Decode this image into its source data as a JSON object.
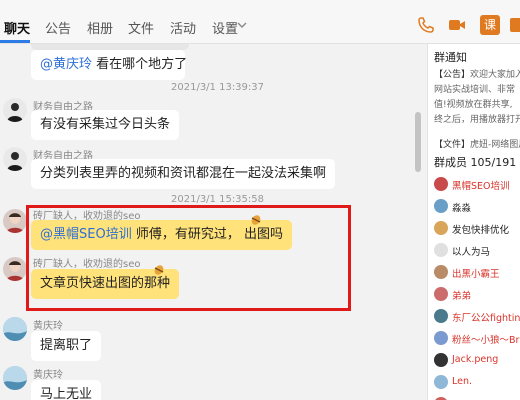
{
  "tabs": [
    {
      "label": "聊天",
      "active": true
    },
    {
      "label": "公告"
    },
    {
      "label": "相册"
    },
    {
      "label": "文件"
    },
    {
      "label": "活动"
    },
    {
      "label": "设置"
    }
  ],
  "toolbar": {
    "phone_icon": "phone-icon",
    "video_icon": "video-icon",
    "lesson_label": "课",
    "more_icon": "more-icon"
  },
  "chat": {
    "prev_mention": "@黄庆玲",
    "prev_text": " 看在哪个地方了",
    "time1": "2021/3/1 13:39:37",
    "msg1_sender": "财务自由之路",
    "msg1_text": "有没有采集过今日头条",
    "msg2_sender": "财务自由之路",
    "msg2_text": "分类列表里弄的视频和资讯都混在一起没法采集啊",
    "time2": "2021/3/1 15:35:58",
    "msg3_sender": "砖厂缺人，收劝退的seo",
    "msg3_mention": "@黑帽SEO培训",
    "msg3_text": " 师傅，有研究过， 出图吗",
    "msg4_sender": "砖厂缺人，收劝退的seo",
    "msg4_text": "文章页快速出图的那种",
    "msg5_sender": "黄庆玲",
    "msg5_text": "提离职了",
    "msg6_sender": "黄庆玲",
    "msg6_text": "马上无业",
    "highlight_color": "#e01919",
    "bubble_highlight_color": "#ffe27a"
  },
  "panel": {
    "notice_title": "群通知",
    "notice_lines": [
      {
        "tag": "【公告】",
        "text": "欢迎大家加入群"
      },
      {
        "tag": "",
        "text": "网站实战培训、非常"
      },
      {
        "tag": "",
        "text": "值!视频放在群共享,"
      },
      {
        "tag": "",
        "text": "终之后，用播放器打开"
      }
    ],
    "file_line_tag": "【文件】",
    "file_line_text": "虎妞-网络图片",
    "members_title": "群成员 105/191",
    "members": [
      {
        "name": "黑帽SEO培训",
        "color": "#d9342b"
      },
      {
        "name": "淼淼",
        "color": "#222222"
      },
      {
        "name": "发包快排优化",
        "color": "#222222"
      },
      {
        "name": "以人为马",
        "color": "#222222"
      },
      {
        "name": "出黑小霸王",
        "color": "#d9342b"
      },
      {
        "name": "弟弟",
        "color": "#d9342b"
      },
      {
        "name": "东厂公公fighting",
        "color": "#d9342b"
      },
      {
        "name": "粉丝～小狼～Bruce",
        "color": "#d9342b"
      },
      {
        "name": "Jack.peng",
        "color": "#d9342b"
      },
      {
        "name": "Len.",
        "color": "#d9342b"
      },
      {
        "name": "良仔哥哥",
        "color": "#d9342b"
      }
    ]
  }
}
